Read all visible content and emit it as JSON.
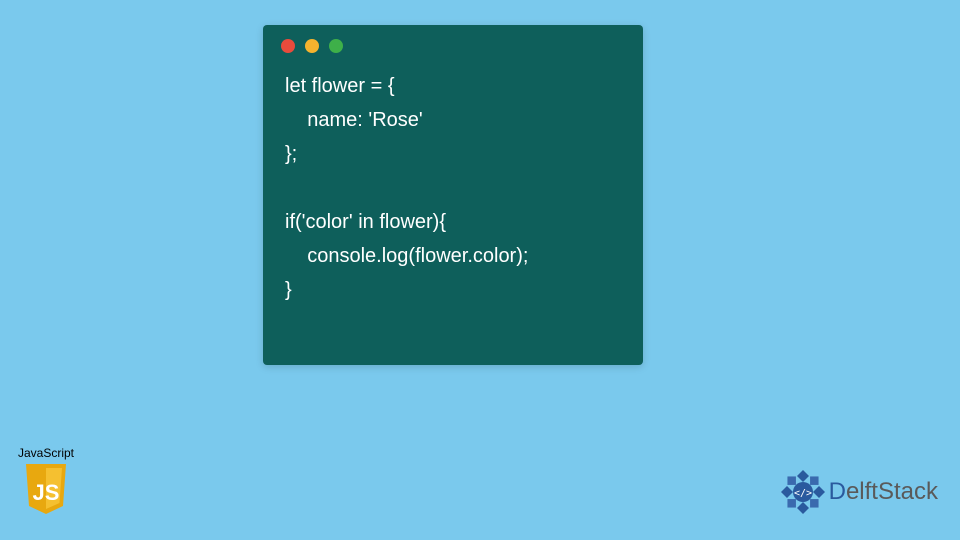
{
  "code": {
    "line1": "let flower = {",
    "line2": "    name: 'Rose'",
    "line3": "};",
    "line4": "",
    "line5": "if('color' in flower){",
    "line6": "    console.log(flower.color);",
    "line7": "}"
  },
  "jsBadge": {
    "label": "JavaScript",
    "shieldText": "JS"
  },
  "delftLogo": {
    "firstLetter": "D",
    "rest": "elftStack"
  },
  "colors": {
    "background": "#7ac9ed",
    "codeWindow": "#0e5f5b",
    "jsShield": "#f0c022",
    "delftBlue": "#2a5a9e"
  }
}
